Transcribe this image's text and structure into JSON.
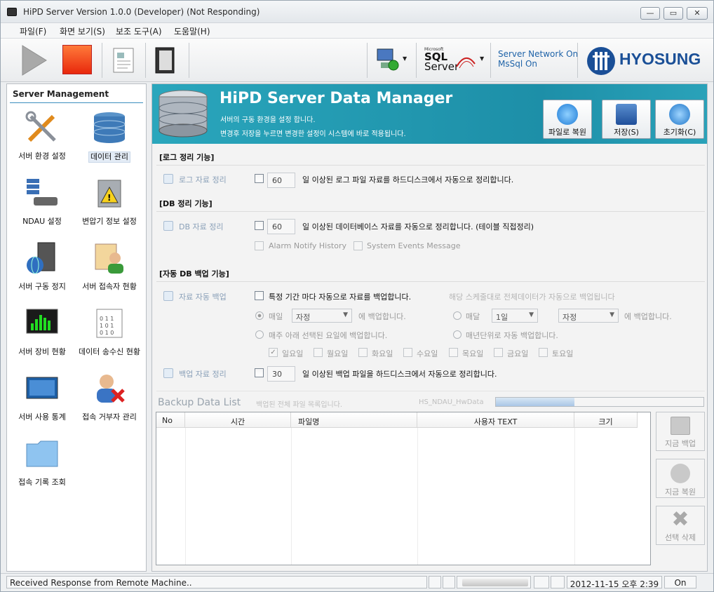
{
  "window": {
    "title": "HiPD Server Version 1.0.0 (Developer) (Not Responding)"
  },
  "menu": {
    "items": [
      "파일(F)",
      "화면 보기(S)",
      "보조 도구(A)",
      "도움말(H)"
    ]
  },
  "toolbar": {
    "sql_small": "Microsoft",
    "sql_line1": "SQL",
    "sql_line2": "Server",
    "status_line1": "Server Network On",
    "status_line2": "MsSql On",
    "brand": "HYOSUNG"
  },
  "sidebar": {
    "title": "Server Management",
    "items": [
      "서버 환경 설정",
      "데이터 관리",
      "NDAU 설정",
      "변압기 정보 설정",
      "서버 구동 정지",
      "서버 접속자 현황",
      "서버 장비 현황",
      "데이터 송수신 현황",
      "서버 사용 통계",
      "접속 거부자 관리",
      "접속 기록 조회"
    ]
  },
  "banner": {
    "title": "HiPD Server Data Manager",
    "line1": "서버의 구동 환경을 설정 합니다.",
    "line2": "변경후 저장을 누르면 변경한 설정이 시스템에 바로 적용됩니다.",
    "btn_restore": "파일로 복원",
    "btn_save": "저장(S)",
    "btn_reset": "초기화(C)"
  },
  "log": {
    "header": "[로그 정리 기능]",
    "label": "로그 자료 정리",
    "days": "60",
    "desc": "일 이상된 로그 파일 자료를 하드디스크에서 자동으로 정리합니다."
  },
  "db": {
    "header": "[DB 정리 기능]",
    "label": "DB 자료 정리",
    "days": "60",
    "desc": "일 이상된 데이터베이스 자료를 자동으로 정리합니다. (테이블 직접정리)",
    "opt1": "Alarm Notify History",
    "opt2": "System Events Message"
  },
  "backup": {
    "header": "[자동 DB 백업 기능]",
    "label": "자료 자동 백업",
    "desc": "특정 기간 마다 자동으로 자료를 백업합니다.",
    "hint": "해당 스케줄대로 전체데이터가 자동으로 백업됩니다",
    "daily": "매일",
    "daily_sel": "자정",
    "daily_suffix": "에 백업합니다.",
    "monthly": "매달",
    "monthly_day": "1일",
    "monthly_sel": "자정",
    "monthly_suffix": "에 백업합니다.",
    "weekly": "매주 아래 선택된 요일에 백업합니다.",
    "yearly": "매년단위로 자동 백업합니다.",
    "days": [
      "일요일",
      "월요일",
      "화요일",
      "수요일",
      "목요일",
      "금요일",
      "토요일"
    ],
    "clean_label": "백업 자료 정리",
    "clean_days": "30",
    "clean_desc": "일 이상된 백업 파일을 하드디스크에서 자동으로 정리합니다."
  },
  "list": {
    "title": "Backup Data List",
    "subtitle": "백업된 전체 파일 목록입니다.",
    "db_name": "HS_NDAU_HwData",
    "columns": [
      "No",
      "시간",
      "파일명",
      "사용자 TEXT",
      "크기"
    ],
    "btn_backup": "지금 백업",
    "btn_restore": "지금 복원",
    "btn_delete": "선택 삭제"
  },
  "status": {
    "message": "Received Response from Remote Machine..",
    "datetime": "2012-11-15 오후 2:39",
    "state": "On"
  }
}
